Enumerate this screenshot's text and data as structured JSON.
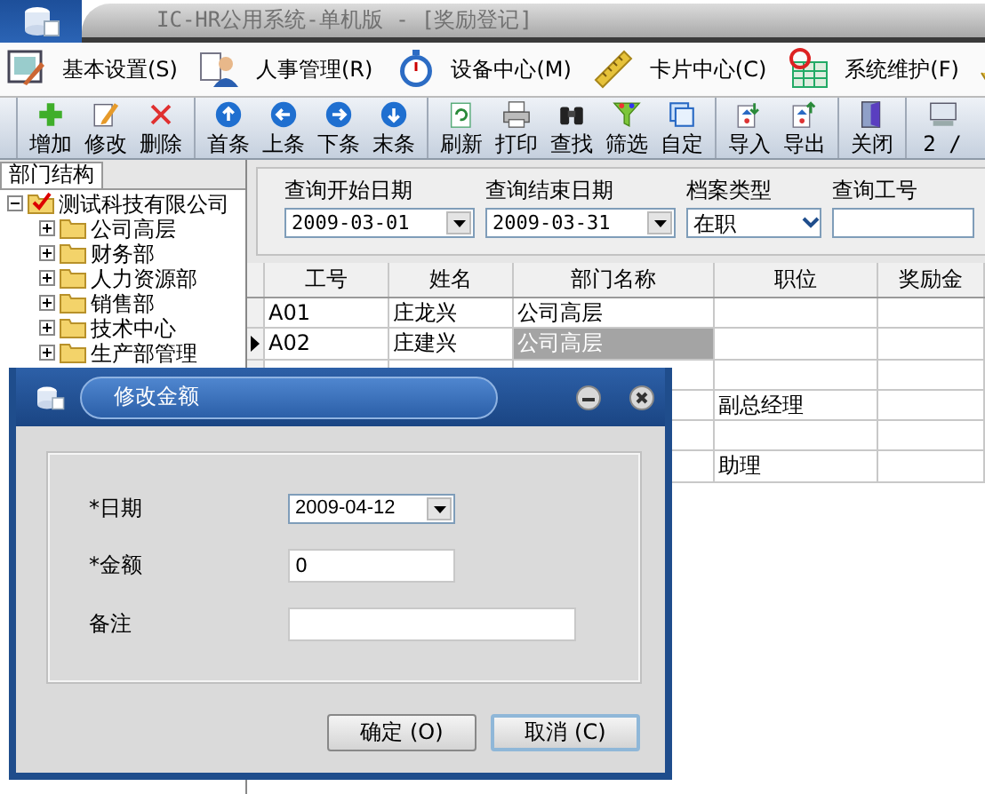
{
  "window": {
    "title": "IC-HR公用系统-单机版 - [奖励登记]"
  },
  "menu": [
    "基本设置(S)",
    "人事管理(R)",
    "设备中心(M)",
    "卡片中心(C)",
    "系统维护(F)"
  ],
  "toolbar": {
    "groups": [
      [
        "增加",
        "修改",
        "删除"
      ],
      [
        "首条",
        "上条",
        "下条",
        "末条"
      ],
      [
        "刷新",
        "打印",
        "查找",
        "筛选",
        "自定"
      ],
      [
        "导入",
        "导出"
      ],
      [
        "关闭"
      ]
    ],
    "record": "2 /"
  },
  "sidebar": {
    "tab": "部门结构",
    "tree": [
      {
        "label": "测试科技有限公司",
        "expanded": true,
        "children": [
          {
            "label": "公司高层",
            "expanded": false
          },
          {
            "label": "财务部",
            "expanded": false
          },
          {
            "label": "人力资源部",
            "expanded": false
          },
          {
            "label": "销售部",
            "expanded": false
          },
          {
            "label": "技术中心",
            "expanded": false
          },
          {
            "label": "生产部管理",
            "expanded": false
          }
        ]
      }
    ]
  },
  "query": {
    "fields": [
      {
        "label": "查询开始日期",
        "value": "2009-03-01",
        "kind": "date"
      },
      {
        "label": "查询结束日期",
        "value": "2009-03-31",
        "kind": "date"
      },
      {
        "label": "档案类型",
        "value": "在职",
        "kind": "select"
      },
      {
        "label": "查询工号",
        "kind": "text"
      }
    ]
  },
  "table": {
    "columns": [
      "工号",
      "姓名",
      "部门名称",
      "职位",
      "奖励金"
    ],
    "rows": [
      {
        "id": "A01",
        "name": "庄龙兴",
        "department": "公司高层",
        "selected": false
      },
      {
        "id": "A02",
        "name": "庄建兴",
        "department": "公司高层",
        "selected": true
      },
      {
        "selected": false
      },
      {
        "position": "副总经理",
        "selected": false
      },
      {
        "selected": false
      },
      {
        "position": "助理",
        "selected": false
      }
    ]
  },
  "dialog": {
    "title": "修改金额",
    "fields": [
      {
        "label": "*日期",
        "value": "2009-04-12",
        "kind": "date"
      },
      {
        "label": "*金额",
        "value": "0",
        "kind": "text"
      },
      {
        "label": "备注",
        "kind": "text"
      }
    ],
    "buttons": [
      {
        "label": "确定 (O)",
        "focused": false
      },
      {
        "label": "取消 (C)",
        "focused": true
      }
    ]
  }
}
